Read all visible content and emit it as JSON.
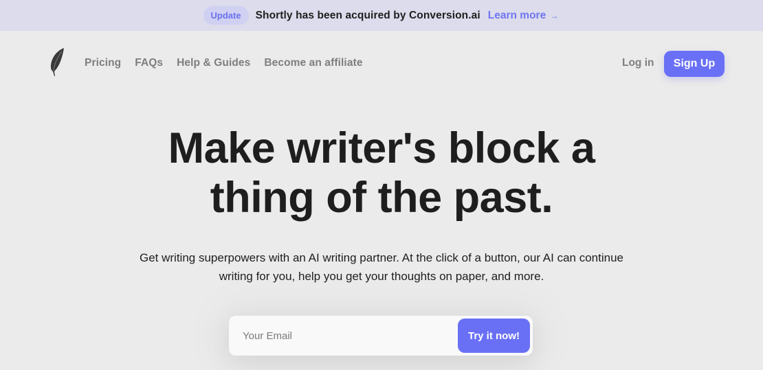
{
  "announcement": {
    "badge": "Update",
    "text": "Shortly has been acquired by Conversion.ai",
    "link_label": "Learn more",
    "link_icon": "→"
  },
  "nav": {
    "logo": "feather-logo",
    "links": [
      {
        "label": "Pricing"
      },
      {
        "label": "FAQs"
      },
      {
        "label": "Help & Guides"
      },
      {
        "label": "Become an affiliate"
      }
    ],
    "login_label": "Log in",
    "signup_label": "Sign Up"
  },
  "hero": {
    "title_line1": "Make writer's block a",
    "title_line2": "thing of the past.",
    "subtitle_line1": "Get writing superpowers with an AI writing partner. At the click of a button, our AI can continue",
    "subtitle_line2": "writing for you, help you get your thoughts on paper, and more."
  },
  "form": {
    "email_placeholder": "Your Email",
    "email_value": "",
    "submit_label": "Try it now!"
  },
  "colors": {
    "accent": "#6a70f5",
    "announcement_bg": "#dcdcec",
    "page_bg": "#ebebeb",
    "text": "#1e1e1e",
    "nav_text": "#7e7e7e"
  }
}
